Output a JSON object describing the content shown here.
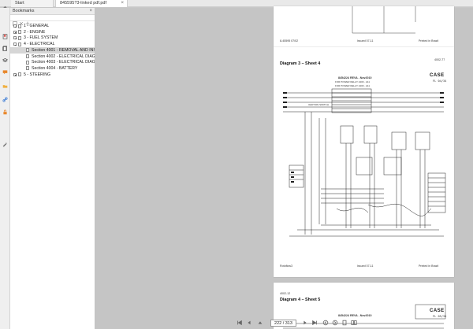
{
  "tabs": [
    {
      "label": "Start"
    },
    {
      "label": "845595?3-linked pdf.pdf"
    }
  ],
  "bookmarks": {
    "title": "Bookmarks",
    "items": [
      {
        "label": "1 - GENERAL",
        "level": 0,
        "toggle": "plus"
      },
      {
        "label": "2 - ENGINE",
        "level": 0,
        "toggle": "plus"
      },
      {
        "label": "3 - FUEL SYSTEM",
        "level": 0,
        "toggle": "plus"
      },
      {
        "label": "4 - ELECTRICAL",
        "level": 0,
        "toggle": "minus"
      },
      {
        "label": "Section 4001 - REMOVAL AND INS",
        "level": 1,
        "selected": true
      },
      {
        "label": "Section 4002 - ELECTRICAL DIAGR",
        "level": 1
      },
      {
        "label": "Section 4003 - ELECTRICAL DIAGR",
        "level": 1
      },
      {
        "label": "Section 4004 - BATTERY",
        "level": 1
      },
      {
        "label": "5 - STEERING",
        "level": 0,
        "toggle": "plus"
      }
    ]
  },
  "pages": {
    "prev_footer_left": "8-45595 07/02",
    "prev_footer_mid": "Issued 07-11",
    "prev_footer_right": "Printed in Brazil",
    "p1_header_right": "4002-77",
    "p1_title": "Diagram 3 – Sheet 4",
    "p1_brand": "CASE",
    "p1_code": "FL 04/34",
    "p1_subtitle": "8454224 REVA - Nov2010",
    "p1_switch": "IGNITION SWITCH",
    "p1_relay1": "FOR POWER RELAY 4400 - A11",
    "p1_relay2": "FOR POWER RELAY 4400 - A11",
    "p1_footer_left": "Rotoflow3",
    "p1_footer_mid": "Issued 07-11",
    "p1_footer_right": "Printed in Brazil",
    "p2_header_left": "4002-12",
    "p2_title": "Diagram 4 – Sheet 5",
    "p2_brand": "CASE",
    "p2_subtitle": "8454224 REVA - Nov2010",
    "p2_code": "FL 05/34"
  },
  "pager": {
    "current": "222 / 313"
  },
  "colors": {
    "accent": "#e8872b",
    "panel": "#ffffff",
    "workspace": "#c5c5c5"
  }
}
